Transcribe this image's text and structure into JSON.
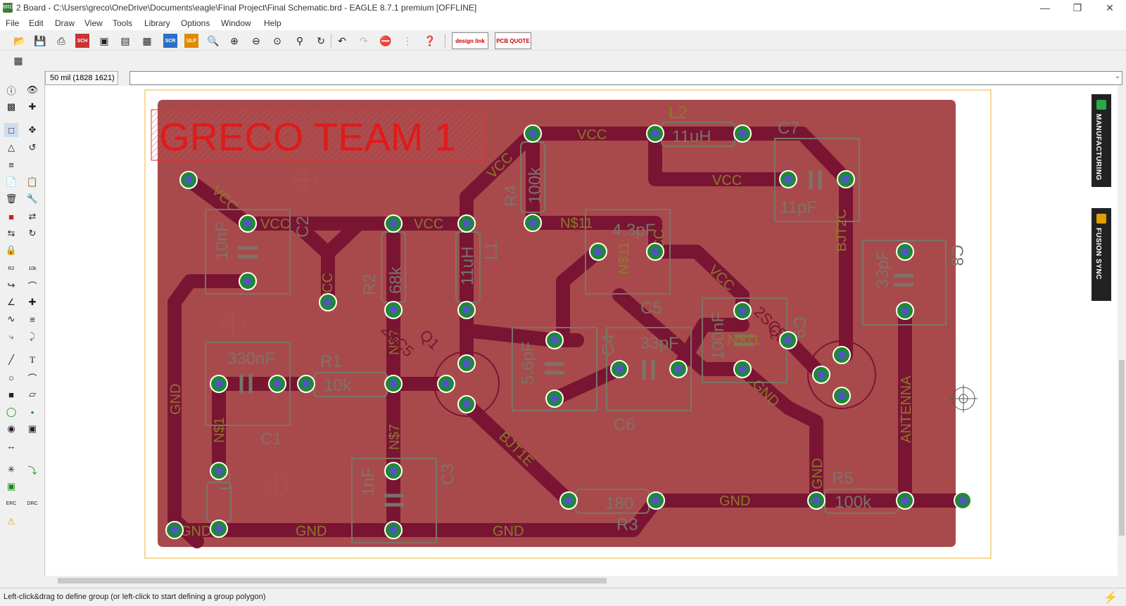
{
  "window": {
    "title": "2 Board - C:\\Users\\greco\\OneDrive\\Documents\\eagle\\Final Project\\Final Schematic.brd - EAGLE 8.7.1 premium [OFFLINE]",
    "app_icon_text": "BRD"
  },
  "menu": [
    "File",
    "Edit",
    "Draw",
    "View",
    "Tools",
    "Library",
    "Options",
    "Window",
    "Help"
  ],
  "toolbar": {
    "design_link_label": "design link",
    "pcb_quote_label": "PCB QUOTE"
  },
  "coord": {
    "readout": "50 mil (1828 1621)"
  },
  "board": {
    "title": "GRECO TEAM 1",
    "labels": {
      "l2": "L2",
      "l2_val": "11uH",
      "c7": "C7",
      "c7_val": "11pF",
      "c8": "C8",
      "c8_val": "33pF",
      "r4": "R4",
      "r4_val": "100k",
      "c2": "C2",
      "c2_val": "10nF",
      "r2": "R2",
      "r2_val": "68k",
      "l1": "L1",
      "l1_val": "11uH",
      "c5": "C5",
      "c5_val": "4.3pF",
      "c4": "C4",
      "c4_val": "5.6pF",
      "c6": "C6",
      "c6_val": "33pF",
      "c9": "C9",
      "c9_val": "100nF",
      "r1": "R1",
      "r1_val": "10k",
      "c1": "C1",
      "c1_val": "330nF",
      "l3": "L3",
      "c3": "C3",
      "c3_val": "1nF",
      "r3": "R3",
      "r3_val": "180",
      "r5": "R5",
      "r5_val": "100k",
      "q1": "Q1",
      "q2": "Q2",
      "q_part": "2SC5",
      "bjt2c": "BJT2C",
      "bjt1e": "BJT1E",
      "vcc": "VCC",
      "gnd": "GND",
      "n11": "N$11",
      "n7": "N$7",
      "n1": "N$1",
      "antenna": "ANTENNA"
    }
  },
  "side_tabs": {
    "manufacturing": "MANUFACTURING",
    "fusion_sync": "FUSION SYNC"
  },
  "status": {
    "message": "Left-click&drag to define group (or left-click to start defining a group polygon)"
  },
  "colors": {
    "board_fill": "#a84a4c",
    "trace": "#7a1433",
    "pad_ring": "#1f8a2e",
    "pad_hole": "#4a5ab8",
    "silk": "#8c7a2a",
    "title_red": "#e01a1a",
    "outline": "#f0b030"
  }
}
